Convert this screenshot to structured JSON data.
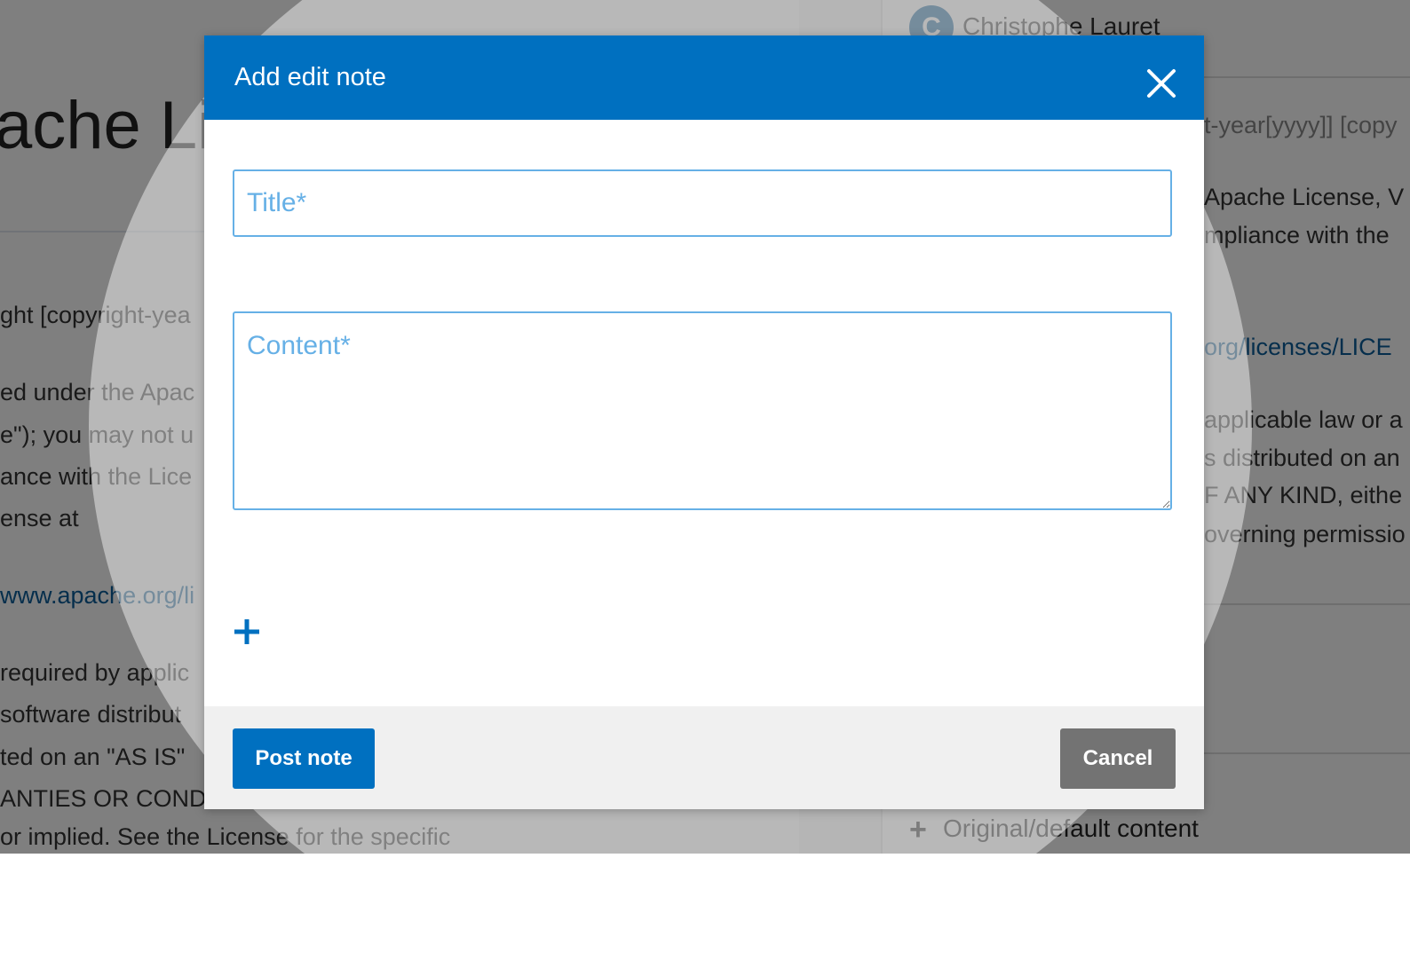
{
  "background": {
    "heading": "ache Li",
    "user": {
      "avatar_letter": "C",
      "name": "Christophe Lauret"
    },
    "left_lines": [
      "ght [copyright-yea",
      "ed under the Apac",
      "e\"); you may not u",
      "ance with the Lice",
      "ense at",
      "www.apache.org/li",
      "required by applic",
      " software distribut",
      "ted on an \"AS IS\"",
      "ANTIES OR COND",
      "or implied. See the License for the specific"
    ],
    "right_lines": [
      "t-year[yyyy]] [copy",
      "Apache License, V",
      "mpliance with the",
      "org/licenses/LICE",
      "applicable law or a",
      "s distributed on an",
      "F ANY KIND, eithe",
      "overning permissio"
    ],
    "right_footer_label": "Original/default content",
    "right_footer_icon": "plus-icon"
  },
  "modal": {
    "title": "Add edit note",
    "close_icon": "close-icon",
    "title_placeholder": "Title*",
    "title_value": "",
    "content_placeholder": "Content*",
    "content_value": "",
    "add_icon": "plus-icon",
    "post_label": "Post note",
    "cancel_label": "Cancel"
  },
  "colors": {
    "header_blue": "#0070c0",
    "field_border": "#66b0e6",
    "cancel_grey": "#737373",
    "footer_bg": "#f0f0f0"
  }
}
